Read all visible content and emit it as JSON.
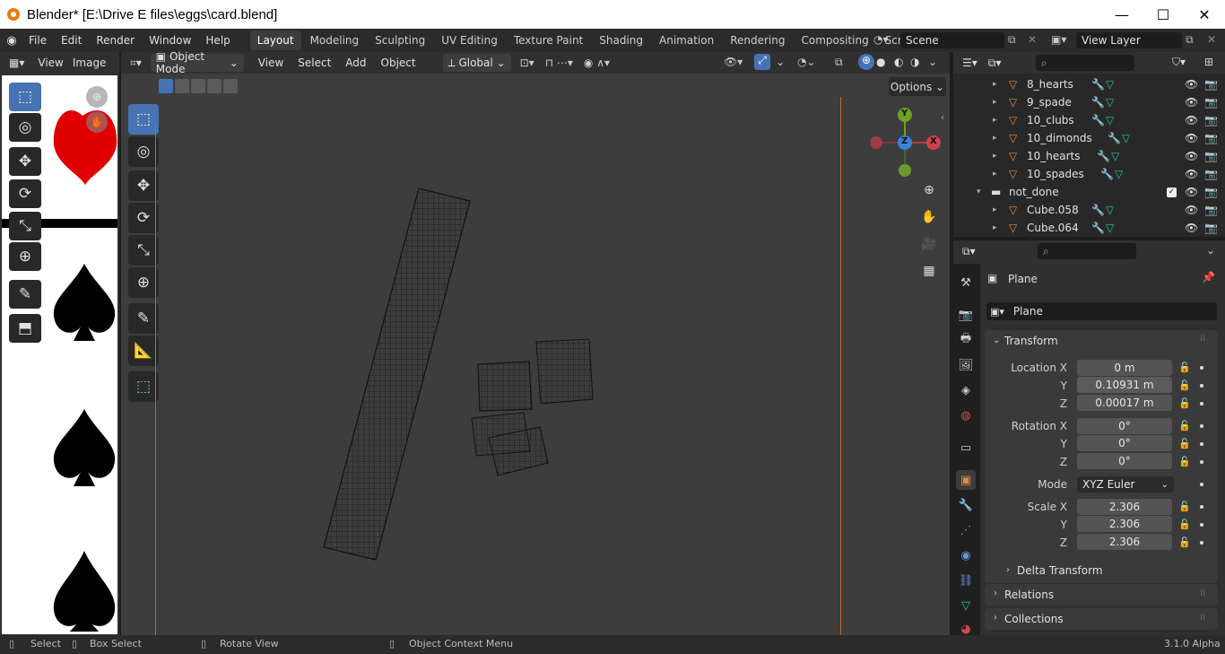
{
  "window": {
    "title": "Blender* [E:\\Drive E files\\eggs\\card.blend]",
    "minimize": "—",
    "maximize": "☐",
    "close": "✕"
  },
  "menus": [
    "File",
    "Edit",
    "Render",
    "Window",
    "Help"
  ],
  "workspaces": [
    "Layout",
    "Modeling",
    "Sculpting",
    "UV Editing",
    "Texture Paint",
    "Shading",
    "Animation",
    "Rendering",
    "Compositing",
    "Scripting"
  ],
  "scene": {
    "name": "Scene",
    "view_layer": "View Layer"
  },
  "image_editor": {
    "menu_view": "View",
    "menu_image": "Image"
  },
  "viewport": {
    "mode": "Object Mode",
    "menu": [
      "View",
      "Select",
      "Add",
      "Object"
    ],
    "orientation": "Global",
    "options": "Options",
    "gizmo": {
      "x": "X",
      "y": "Y",
      "z": "Z"
    }
  },
  "outliner": {
    "rows": [
      {
        "name": "8_hearts",
        "type": "object"
      },
      {
        "name": "9_spade",
        "type": "object"
      },
      {
        "name": "10_clubs",
        "type": "object"
      },
      {
        "name": "10_dimonds",
        "type": "object"
      },
      {
        "name": "10_hearts",
        "type": "object"
      },
      {
        "name": "10_spades",
        "type": "object"
      },
      {
        "name": "not_done",
        "type": "collection"
      },
      {
        "name": "Cube.058",
        "type": "object"
      },
      {
        "name": "Cube.064",
        "type": "object"
      }
    ]
  },
  "properties": {
    "object_name": "Plane",
    "datablock": "Plane",
    "transform_label": "Transform",
    "location": {
      "label_x": "Location X",
      "x": "0 m",
      "y": "0.10931 m",
      "z": "0.00017 m"
    },
    "rotation": {
      "label_x": "Rotation X",
      "x": "0°",
      "y": "0°",
      "z": "0°"
    },
    "mode_label": "Mode",
    "mode": "XYZ Euler",
    "scale": {
      "label_x": "Scale X",
      "x": "2.306",
      "y": "2.306",
      "z": "2.306"
    },
    "axis_y": "Y",
    "axis_z": "Z",
    "delta_transform": "Delta Transform",
    "relations": "Relations",
    "collections": "Collections"
  },
  "statusbar": {
    "select": "Select",
    "box_select": "Box Select",
    "rotate": "Rotate View",
    "context_menu": "Object Context Menu",
    "version": "3.1.0 Alpha"
  },
  "colors": {
    "accent": "#4772b3",
    "object": "#e38b3a",
    "mesh_data": "#29c798",
    "modifier": "#6d95e0"
  }
}
